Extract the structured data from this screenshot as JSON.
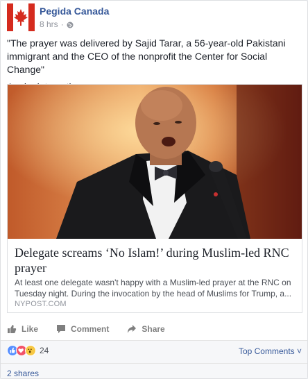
{
  "post": {
    "page_name": "Pegida Canada",
    "timestamp": "8 hrs",
    "separator": "·",
    "privacy_icon": "globe-icon",
    "text_lines": [
      "\"The prayer was delivered by Sajid Tarar, a 56-year-old Pakistani immigrant and the CEO of the nonprofit the Center for Social Change\"",
      "Again, interesting."
    ]
  },
  "link": {
    "title": "Delegate screams ‘No Islam!’ during Muslim-led RNC prayer",
    "description": "At least one delegate wasn't happy with a Muslim-led prayer at the RNC on Tuesday night. During the invocation by the head of Muslims for Trump, a...",
    "domain": "NYPOST.COM"
  },
  "actions": {
    "like": "Like",
    "comment": "Comment",
    "share": "Share"
  },
  "reactions": {
    "icons": [
      "like-reaction-icon",
      "love-reaction-icon",
      "wow-reaction-icon"
    ],
    "count": "24",
    "top_comments": "Top Comments ˅"
  },
  "shares": "2 shares",
  "colors": {
    "link_blue": "#365899",
    "muted": "#90949c",
    "like_blue": "#5890ff",
    "love_red": "#f25268",
    "wow_yellow": "#f7c844"
  }
}
